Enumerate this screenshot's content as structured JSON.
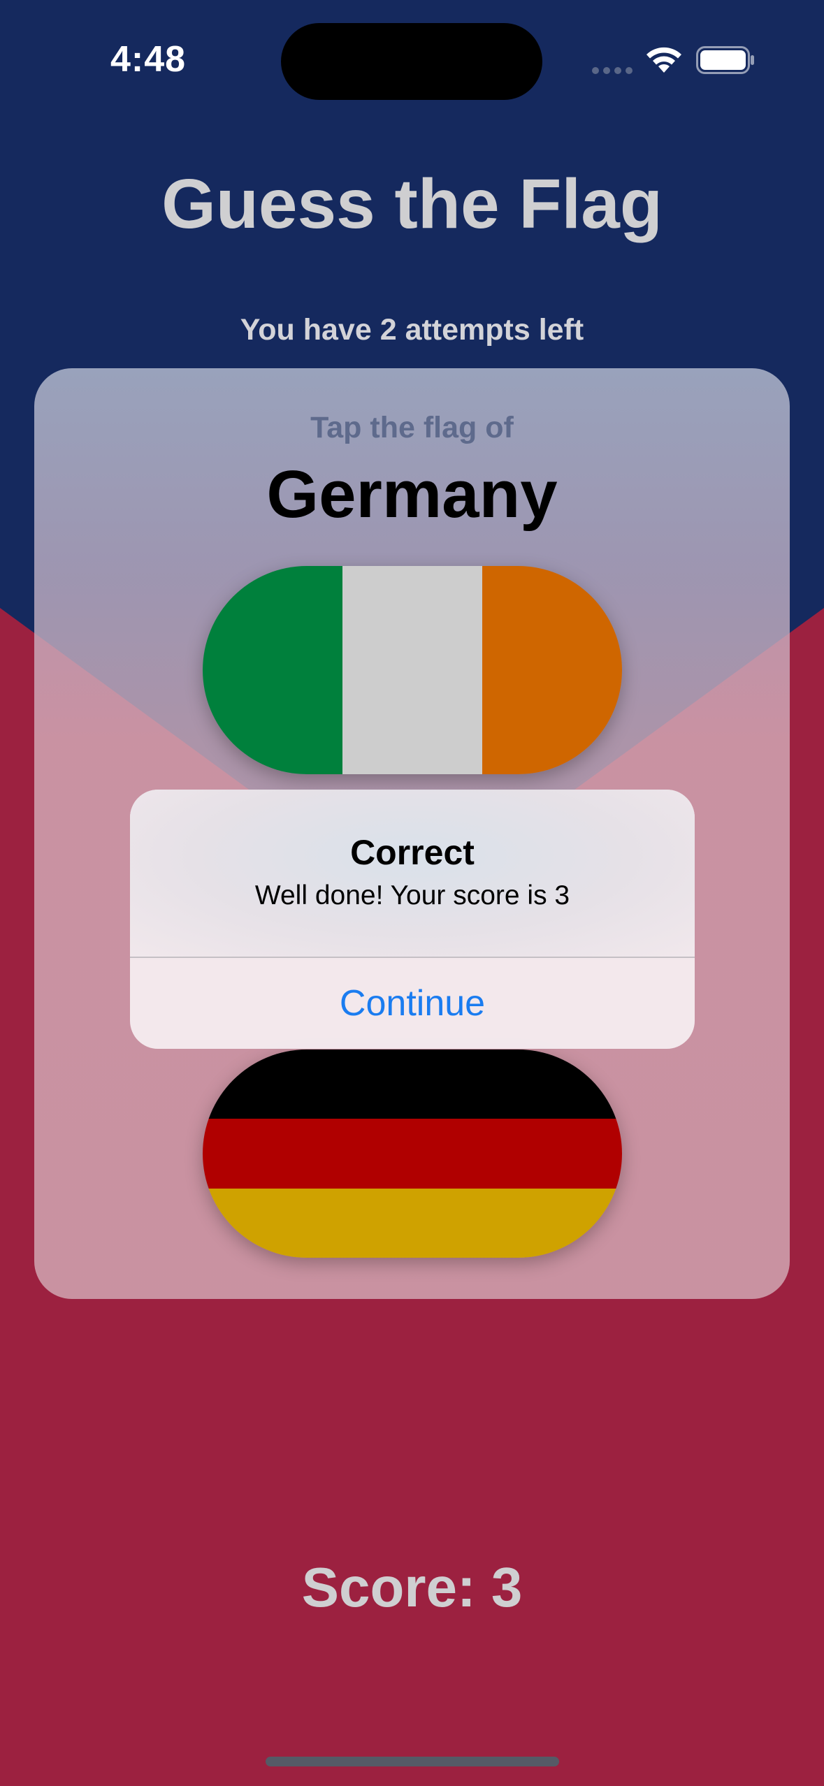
{
  "status_bar": {
    "time": "4:48",
    "icons": [
      "cellular-signal-icon",
      "wifi-icon",
      "battery-icon"
    ]
  },
  "header": {
    "title": "Guess the Flag",
    "attempts": "You have 2 attempts left"
  },
  "card": {
    "prompt": "Tap the flag of",
    "country": "Germany",
    "flags": [
      {
        "country": "Ireland",
        "stripes": [
          "#00803c",
          "#cdcdcd",
          "#cf6600"
        ],
        "orientation": "vertical"
      },
      {
        "country": "Germany",
        "stripes": [
          "#000000",
          "#b00000",
          "#cfa200"
        ],
        "orientation": "horizontal"
      }
    ]
  },
  "alert": {
    "title": "Correct",
    "message": "Well done! Your score is 3",
    "button_label": "Continue"
  },
  "footer": {
    "score": "Score: 3"
  },
  "colors": {
    "top_background": "#15295e",
    "bottom_background": "#9c2140",
    "accent": "#1a7cf0",
    "title_text": "#cfcfd1"
  }
}
